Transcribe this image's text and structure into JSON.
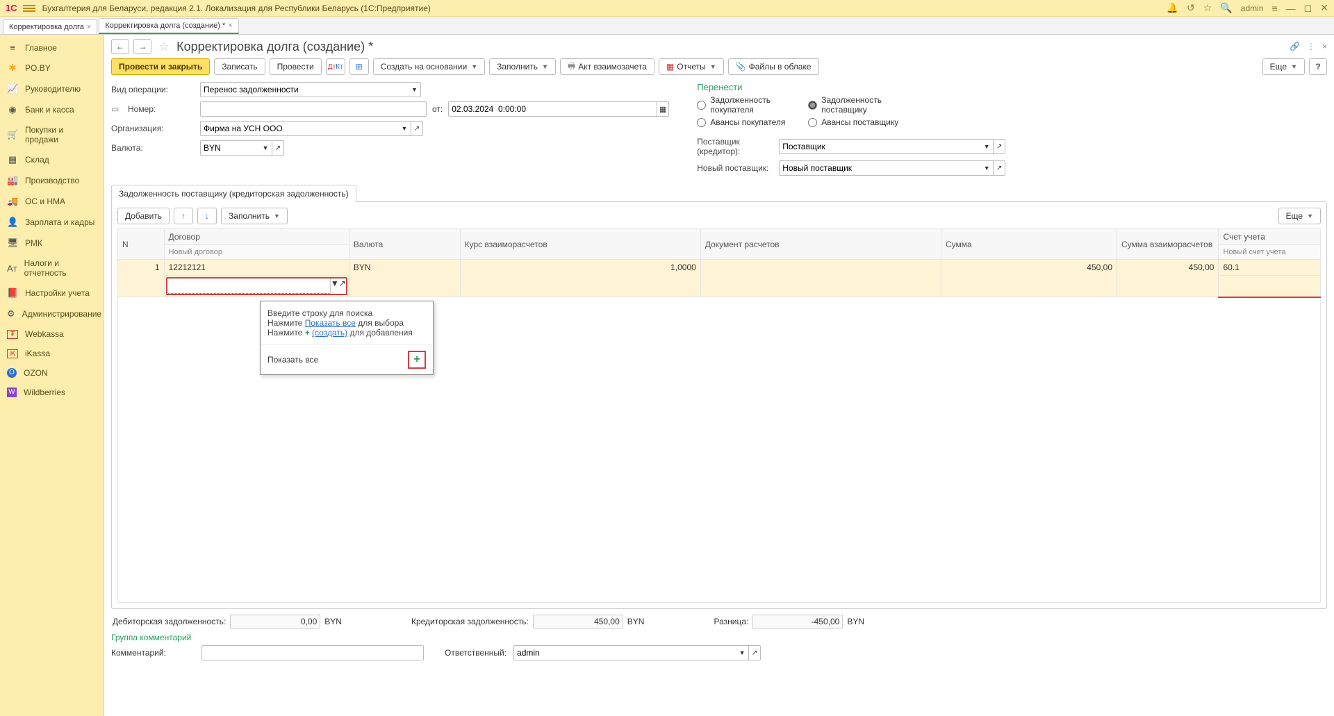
{
  "titlebar": {
    "app_title": "Бухгалтерия для Беларуси, редакция 2.1. Локализация для Республики Беларусь   (1С:Предприятие)",
    "user": "admin"
  },
  "tabs": [
    {
      "label": "Корректировка долга",
      "active": false
    },
    {
      "label": "Корректировка долга (создание) *",
      "active": true
    }
  ],
  "sidebar": [
    {
      "icon": "≡",
      "label": "Главное"
    },
    {
      "icon": "✱",
      "label": "PO.BY"
    },
    {
      "icon": "📈",
      "label": "Руководителю"
    },
    {
      "icon": "₽",
      "label": "Банк и касса"
    },
    {
      "icon": "🛒",
      "label": "Покупки и продажи"
    },
    {
      "icon": "▦",
      "label": "Склад"
    },
    {
      "icon": "🏭",
      "label": "Производство"
    },
    {
      "icon": "🚚",
      "label": "ОС и НМА"
    },
    {
      "icon": "👤",
      "label": "Зарплата и кадры"
    },
    {
      "icon": "🖥",
      "label": "РМК"
    },
    {
      "icon": "Aᴛ",
      "label": "Налоги и отчетность"
    },
    {
      "icon": "📕",
      "label": "Настройки учета"
    },
    {
      "icon": "⚙",
      "label": "Администрирование"
    },
    {
      "icon": "W",
      "label": "Webkassa"
    },
    {
      "icon": "iK",
      "label": "iKassa"
    },
    {
      "icon": "O",
      "label": "OZON"
    },
    {
      "icon": "W",
      "label": "Wildberries"
    }
  ],
  "page": {
    "title": "Корректировка долга (создание) *"
  },
  "toolbar": {
    "primary": "Провести и закрыть",
    "record": "Записать",
    "post": "Провести",
    "create_based": "Создать на основании",
    "fill": "Заполнить",
    "act": "Акт взаимозачета",
    "reports": "Отчеты",
    "cloud": "Файлы в облаке",
    "more": "Еще"
  },
  "form": {
    "op_type_label": "Вид операции:",
    "op_type_value": "Перенос задолженности",
    "number_label": "Номер:",
    "number_value": "",
    "from_label": "от:",
    "date_value": "02.03.2024  0:00:00",
    "org_label": "Организация:",
    "org_value": "Фирма на УСН ООО",
    "currency_label": "Валюта:",
    "currency_value": "BYN",
    "transfer_header": "Перенести",
    "radio_buyer_debt": "Задолженность покупателя",
    "radio_supplier_debt": "Задолженность поставщику",
    "radio_buyer_adv": "Авансы покупателя",
    "radio_supplier_adv": "Авансы поставщику",
    "supplier_label": "Поставщик (кредитор):",
    "supplier_value": "Поставщик",
    "new_supplier_label": "Новый поставщик:",
    "new_supplier_value": "Новый поставщик"
  },
  "subtab": {
    "label": "Задолженность поставщику (кредиторская задолженность)"
  },
  "grid_toolbar": {
    "add": "Добавить",
    "fill": "Заполнить",
    "more": "Еще"
  },
  "grid": {
    "headers": {
      "n": "N",
      "contract": "Договор",
      "new_contract": "Новый договор",
      "currency": "Валюта",
      "rate": "Курс взаиморасчетов",
      "doc": "Документ расчетов",
      "sum": "Сумма",
      "sum_settle": "Сумма взаиморасчетов",
      "account": "Счет учета",
      "new_account": "Новый счет учета"
    },
    "row": {
      "n": "1",
      "contract": "12212121",
      "currency": "BYN",
      "rate": "1,0000",
      "doc": "",
      "sum": "450,00",
      "sum_settle": "450,00",
      "account": "60.1"
    }
  },
  "popup": {
    "line1": "Введите строку для поиска",
    "line2_a": "Нажмите ",
    "line2_link": "Показать все",
    "line2_b": " для выбора",
    "line3_a": "Нажмите ",
    "line3_link": "(создать)",
    "line3_b": " для добавления",
    "show_all": "Показать все"
  },
  "totals": {
    "debit_label": "Дебиторская задолженность:",
    "debit_val": "0,00",
    "debit_cur": "BYN",
    "credit_label": "Кредиторская задолженность:",
    "credit_val": "450,00",
    "credit_cur": "BYN",
    "diff_label": "Разница:",
    "diff_val": "-450,00",
    "diff_cur": "BYN"
  },
  "comments": {
    "group_header": "Группа комментарий",
    "comment_label": "Комментарий:",
    "comment_value": "",
    "resp_label": "Ответственный:",
    "resp_value": "admin"
  }
}
